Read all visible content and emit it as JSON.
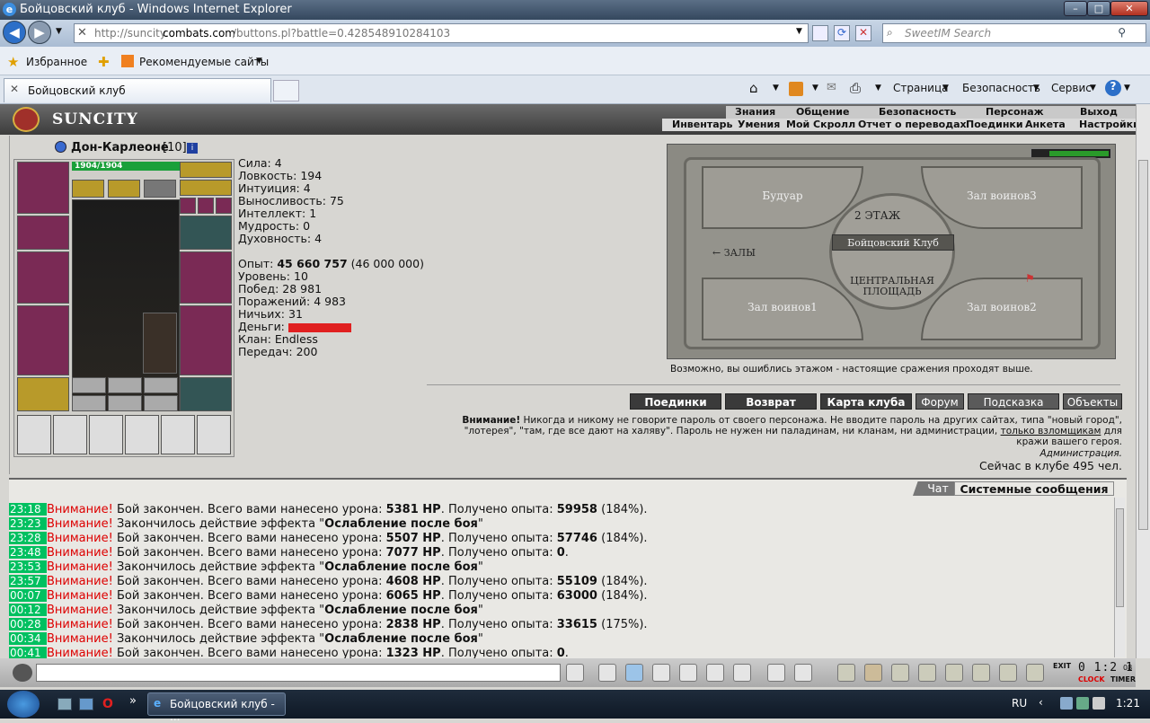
{
  "window": {
    "title": "Бойцовский клуб - Windows Internet Explorer",
    "min": "–",
    "max": "□",
    "close": "✕"
  },
  "nav": {
    "url_prefix": "http://suncity.",
    "url_domain": "combats.com",
    "url_path": "/buttons.pl?battle=0.428548910284103",
    "search_placeholder": "SweetIM Search",
    "favorites": "Избранное",
    "suggested": "Рекомендуемые сайты",
    "tab": "Бойцовский клуб",
    "page_menu": "Страница",
    "safety_menu": "Безопасность",
    "tools_menu": "Сервис"
  },
  "site": {
    "logo": "SUNCITY",
    "top_menu": [
      "Знания",
      "Общение",
      "Безопасность",
      "Персонаж",
      "Выход"
    ],
    "sub_menu": [
      "Инвентарь",
      "Умения",
      "Мой Скролл",
      "Отчет о переводах",
      "Поединки",
      "Анкета",
      "Настройки"
    ]
  },
  "character": {
    "name": "Дон-Карлеоне",
    "level": "[10]",
    "hp": "1904/1904",
    "stats": [
      {
        "label": "Сила:",
        "value": "4"
      },
      {
        "label": "Ловкость:",
        "value": "194"
      },
      {
        "label": "Интуиция:",
        "value": "4"
      },
      {
        "label": "Выносливость:",
        "value": "75"
      },
      {
        "label": "Интеллект:",
        "value": "1"
      },
      {
        "label": "Мудрость:",
        "value": "0"
      },
      {
        "label": "Духовность:",
        "value": "4"
      }
    ],
    "exp_label": "Опыт:",
    "exp": "45 660 757",
    "exp_next": "(46 000 000)",
    "level_label": "Уровень:",
    "level_num": "10",
    "wins_label": "Побед:",
    "wins": "28 981",
    "losses_label": "Поражений:",
    "losses": "4 983",
    "draws_label": "Ничьих:",
    "draws": "31",
    "money_label": "Деньги:",
    "clan_label": "Клан:",
    "clan": "Endless",
    "transfers_label": "Передач:",
    "transfers": "200"
  },
  "map": {
    "rooms": [
      "Будуар",
      "Зал воинов3",
      "Зал воинов1",
      "Зал воинов2"
    ],
    "center": "Бойцовский Клуб",
    "floor": "2 ЭТАЖ",
    "halls": "← ЗАЛЫ",
    "square": "ЦЕНТРАЛЬНАЯ ПЛОЩАДЬ",
    "hint": "Возможно, вы ошиблись этажом - настоящие сражения проходят выше."
  },
  "actions": [
    "Поединки",
    "Возврат",
    "Карта клуба",
    "Форум",
    "Подсказка",
    "Объекты"
  ],
  "notice": {
    "warn": "Внимание!",
    "text1": " Никогда и никому не говорите пароль от своего персонажа. Не вводите пароль на других сайтах, типа \"новый город\",",
    "text2": "\"лотерея\", \"там, где все дают на халяву\". Пароль не нужен ни паладинам, ни кланам, ни администрации,",
    "link": "только взломщикам",
    "text3": " для",
    "text4": "кражи вашего героя.",
    "admin": "Администрация.",
    "online": "Сейчас в клубе 495 чел."
  },
  "chat_tabs": [
    "Чат",
    "Системные сообщения"
  ],
  "log": [
    {
      "t": "23:18",
      "w": "Внимание!",
      "a": " Бой закончен. Всего вами нанесено урона: ",
      "b": "5381 HP",
      "c": ". Получено опыта: ",
      "d": "59958",
      "e": " (184%)."
    },
    {
      "t": "23:23",
      "w": "Внимание!",
      "a": " Закончилось действие эффекта \"",
      "b": "Ослабление после боя",
      "c": "\"",
      "d": "",
      "e": ""
    },
    {
      "t": "23:28",
      "w": "Внимание!",
      "a": " Бой закончен. Всего вами нанесено урона: ",
      "b": "5507 HP",
      "c": ". Получено опыта: ",
      "d": "57746",
      "e": " (184%)."
    },
    {
      "t": "23:48",
      "w": "Внимание!",
      "a": " Бой закончен. Всего вами нанесено урона: ",
      "b": "7077 HP",
      "c": ". Получено опыта: ",
      "d": "0",
      "e": "."
    },
    {
      "t": "23:53",
      "w": "Внимание!",
      "a": " Закончилось действие эффекта \"",
      "b": "Ослабление после боя",
      "c": "\"",
      "d": "",
      "e": ""
    },
    {
      "t": "23:57",
      "w": "Внимание!",
      "a": " Бой закончен. Всего вами нанесено урона: ",
      "b": "4608 HP",
      "c": ". Получено опыта: ",
      "d": "55109",
      "e": " (184%)."
    },
    {
      "t": "00:07",
      "w": "Внимание!",
      "a": " Бой закончен. Всего вами нанесено урона: ",
      "b": "6065 HP",
      "c": ". Получено опыта: ",
      "d": "63000",
      "e": " (184%)."
    },
    {
      "t": "00:12",
      "w": "Внимание!",
      "a": " Закончилось действие эффекта \"",
      "b": "Ослабление после боя",
      "c": "\"",
      "d": "",
      "e": ""
    },
    {
      "t": "00:28",
      "w": "Внимание!",
      "a": " Бой закончен. Всего вами нанесено урона: ",
      "b": "2838 HP",
      "c": ". Получено опыта: ",
      "d": "33615",
      "e": " (175%)."
    },
    {
      "t": "00:34",
      "w": "Внимание!",
      "a": " Закончилось действие эффекта \"",
      "b": "Ослабление после боя",
      "c": "\"",
      "d": "",
      "e": ""
    },
    {
      "t": "00:41",
      "w": "Внимание!",
      "a": " Бой закончен. Всего вами нанесено урона: ",
      "b": "1323 HP",
      "c": ". Получено опыта: ",
      "d": "0",
      "e": "."
    }
  ],
  "bottom": {
    "clock": "0 1:2 1",
    "clock_sec": "08",
    "clock_label": "CLOCK",
    "timer_label": "TIMER",
    "exit": "EXIT"
  },
  "taskbar": {
    "task": "Бойцовский клуб - ...",
    "lang": "RU",
    "time": "1:21",
    "more": "»"
  }
}
